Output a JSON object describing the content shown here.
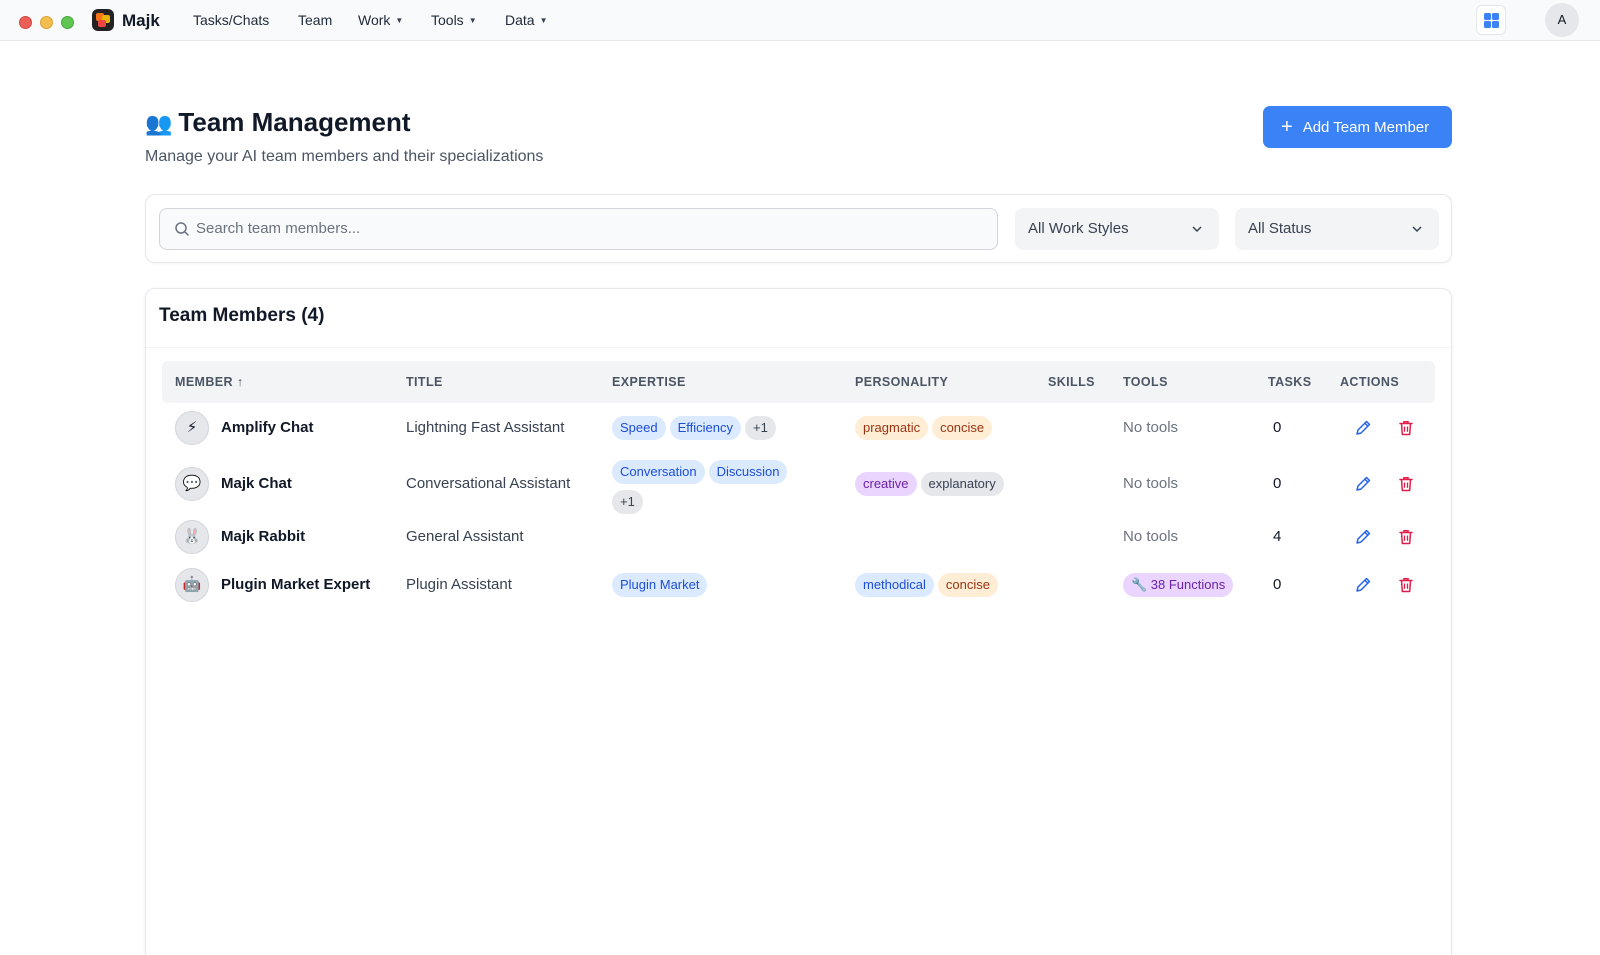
{
  "app": {
    "name": "Majk"
  },
  "nav": [
    {
      "label": "Tasks/Chats",
      "dropdown": false
    },
    {
      "label": "Team",
      "dropdown": false
    },
    {
      "label": "Work",
      "dropdown": true
    },
    {
      "label": "Tools",
      "dropdown": true
    },
    {
      "label": "Data",
      "dropdown": true
    }
  ],
  "user": {
    "initial": "A"
  },
  "header": {
    "emoji": "👥",
    "title": "Team Management",
    "subtitle": "Manage your AI team members and their specializations",
    "add_button": "Add Team Member"
  },
  "filters": {
    "search_placeholder": "Search team members...",
    "work_style": "All Work Styles",
    "status": "All Status"
  },
  "table": {
    "title": "Team Members (4)",
    "columns": {
      "member": "MEMBER",
      "sort_arrow": "↑",
      "title": "TITLE",
      "expertise": "EXPERTISE",
      "personality": "PERSONALITY",
      "skills": "SKILLS",
      "tools": "TOOLS",
      "tasks": "TASKS",
      "actions": "ACTIONS"
    },
    "rows": [
      {
        "avatar": "⚡",
        "name": "Amplify Chat",
        "title": "Lightning Fast Assistant",
        "expertise": [
          "Speed",
          "Efficiency"
        ],
        "expertise_more": "+1",
        "personality": [
          {
            "label": "pragmatic",
            "color": "orange"
          },
          {
            "label": "concise",
            "color": "orange"
          }
        ],
        "tools": "No tools",
        "tasks": "0"
      },
      {
        "avatar": "💬",
        "name": "Majk Chat",
        "title": "Conversational Assistant",
        "expertise": [
          "Conversation",
          "Discussion"
        ],
        "expertise_more": "+1",
        "personality": [
          {
            "label": "creative",
            "color": "purple"
          },
          {
            "label": "explanatory",
            "color": "gray"
          }
        ],
        "tools": "No tools",
        "tasks": "0"
      },
      {
        "avatar": "🐰",
        "name": "Majk Rabbit",
        "title": "General Assistant",
        "expertise": [],
        "personality": [],
        "tools": "No tools",
        "tasks": "4"
      },
      {
        "avatar": "🤖",
        "name": "Plugin Market Expert",
        "title": "Plugin Assistant",
        "expertise": [
          "Plugin Market"
        ],
        "personality": [
          {
            "label": "methodical",
            "color": "blue"
          },
          {
            "label": "concise",
            "color": "orange"
          }
        ],
        "tools_badge": "🔧 38 Functions",
        "tasks": "0"
      }
    ]
  },
  "colors": {
    "accent": "#3b82f6",
    "delete": "#e11d48",
    "edit": "#2563eb"
  }
}
